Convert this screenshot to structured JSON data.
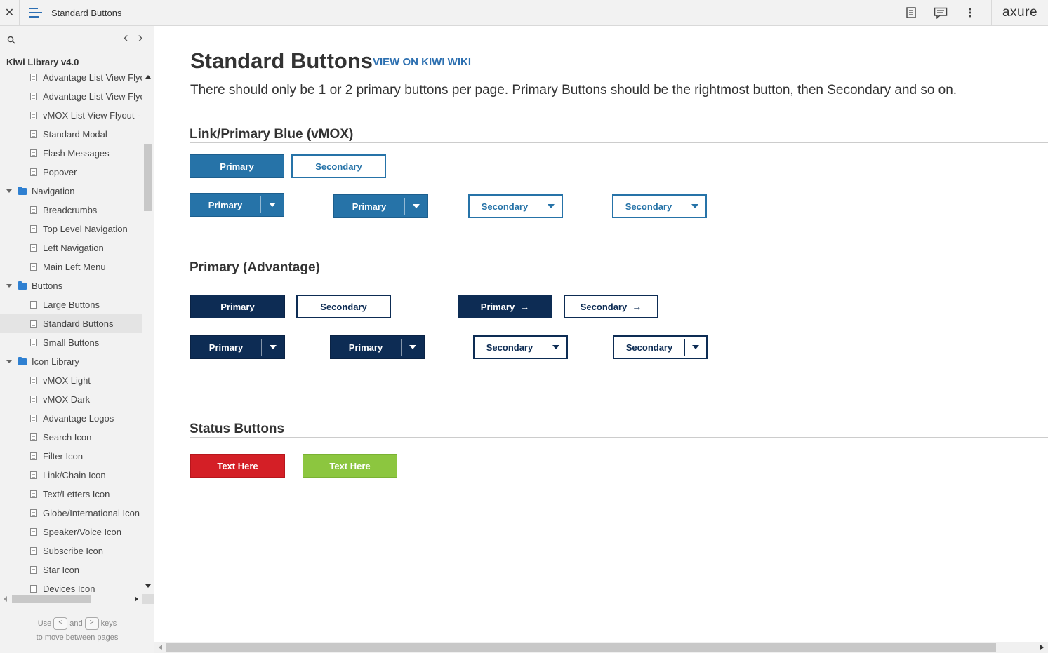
{
  "topbar": {
    "close_glyph": "✕",
    "title": "Standard Buttons",
    "icons": [
      "notes-icon",
      "comments-icon",
      "more-icon"
    ],
    "logo": "axure"
  },
  "sidebar": {
    "library_title": "Kiwi Library v4.0",
    "prev_glyph": "‹",
    "next_glyph": "›",
    "items": [
      {
        "type": "page",
        "label": "Advantage List View Flyout"
      },
      {
        "type": "page",
        "label": "Advantage List View Flyout"
      },
      {
        "type": "page",
        "label": "vMOX List View Flyout - S"
      },
      {
        "type": "page",
        "label": "Standard Modal"
      },
      {
        "type": "page",
        "label": "Flash Messages"
      },
      {
        "type": "page",
        "label": "Popover"
      },
      {
        "type": "folder",
        "label": "Navigation"
      },
      {
        "type": "page",
        "label": "Breadcrumbs"
      },
      {
        "type": "page",
        "label": "Top Level Navigation"
      },
      {
        "type": "page",
        "label": "Left Navigation"
      },
      {
        "type": "page",
        "label": "Main Left Menu"
      },
      {
        "type": "folder",
        "label": "Buttons"
      },
      {
        "type": "page",
        "label": "Large Buttons"
      },
      {
        "type": "page",
        "label": "Standard Buttons",
        "selected": true
      },
      {
        "type": "page",
        "label": "Small Buttons"
      },
      {
        "type": "folder",
        "label": "Icon Library"
      },
      {
        "type": "page",
        "label": "vMOX Light"
      },
      {
        "type": "page",
        "label": "vMOX Dark"
      },
      {
        "type": "page",
        "label": "Advantage Logos"
      },
      {
        "type": "page",
        "label": "Search Icon"
      },
      {
        "type": "page",
        "label": "Filter Icon"
      },
      {
        "type": "page",
        "label": "Link/Chain Icon"
      },
      {
        "type": "page",
        "label": "Text/Letters Icon"
      },
      {
        "type": "page",
        "label": "Globe/International Icon"
      },
      {
        "type": "page",
        "label": "Speaker/Voice Icon"
      },
      {
        "type": "page",
        "label": "Subscribe Icon"
      },
      {
        "type": "page",
        "label": "Star Icon"
      },
      {
        "type": "page",
        "label": "Devices Icon"
      }
    ],
    "hint": {
      "use": "Use",
      "key_prev": "<",
      "and": "and",
      "key_next": ">",
      "keys": "keys",
      "line2": "to move between pages"
    }
  },
  "main": {
    "title": "Standard Buttons",
    "wiki_link": "VIEW ON KIWI WIKI",
    "description": "There should only be 1 or 2 primary buttons per page. Primary Buttons should be the rightmost button, then Secondary and so on.",
    "sections": {
      "link_primary": {
        "heading": "Link/Primary Blue (vMOX)",
        "primary": "Primary",
        "secondary": "Secondary"
      },
      "advantage": {
        "heading": "Primary (Advantage)",
        "primary": "Primary",
        "secondary": "Secondary"
      },
      "status": {
        "heading": "Status Buttons",
        "danger": "Text Here",
        "success": "Text Here"
      }
    },
    "arrow_glyph": "→"
  },
  "colors": {
    "link_blue": "#2673a8",
    "navy": "#0d2c54",
    "danger": "#d41f26",
    "success": "#8cc63f",
    "folder": "#2f80d1"
  }
}
